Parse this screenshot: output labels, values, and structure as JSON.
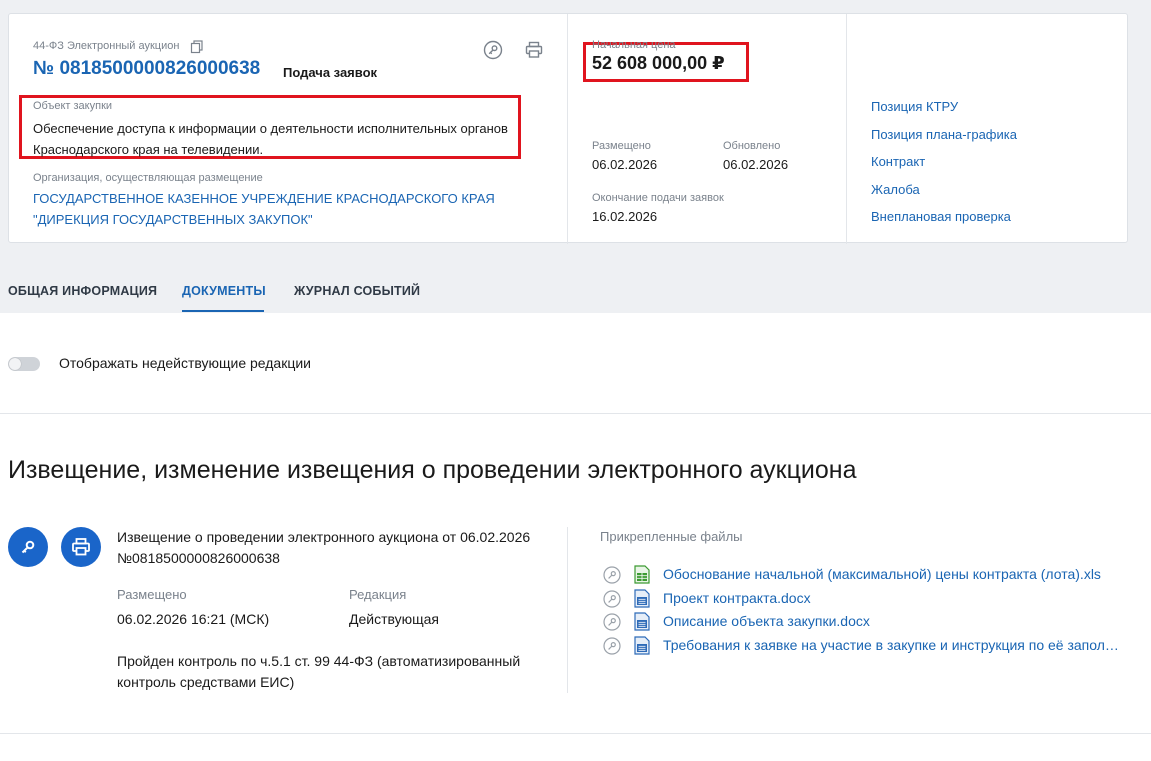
{
  "header": {
    "law_type": "44-ФЗ Электронный аукцион",
    "reg_number": "№ 0818500000826000638",
    "status": "Подача заявок",
    "object_label": "Объект закупки",
    "object_text": "Обеспечение доступа к информации о деятельности исполнительных органов Краснодарского края на телевидении.",
    "org_label": "Организация, осуществляющая размещение",
    "org_text": "ГОСУДАРСТВЕННОЕ КАЗЕННОЕ УЧРЕЖДЕНИЕ КРАСНОДАРСКОГО КРАЯ \"ДИРЕКЦИЯ ГОСУДАРСТВЕННЫХ ЗАКУПОК\""
  },
  "price": {
    "label": "Начальная цена",
    "value": "52 608 000,00 ₽"
  },
  "dates": {
    "placed_label": "Размещено",
    "placed_value": "06.02.2026",
    "updated_label": "Обновлено",
    "updated_value": "06.02.2026",
    "deadline_label": "Окончание подачи заявок",
    "deadline_value": "16.02.2026"
  },
  "side_links": [
    "Позиция КТРУ",
    "Позиция плана-графика",
    "Контракт",
    "Жалоба",
    "Внеплановая проверка"
  ],
  "tabs": [
    "ОБЩАЯ ИНФОРМАЦИЯ",
    "ДОКУМЕНТЫ",
    "ЖУРНАЛ СОБЫТИЙ"
  ],
  "toggle": {
    "label": "Отображать недействующие редакции"
  },
  "section": {
    "title": "Извещение, изменение извещения о проведении электронного аукциона",
    "notice_title": "Извещение о проведении электронного аукциона от 06.02.2026 №0818500000826000638",
    "placed_label": "Размещено",
    "placed_value": "06.02.2026 16:21 (МСК)",
    "edition_label": "Редакция",
    "edition_value": "Действующая",
    "control_text": "Пройден контроль по ч.5.1 ст. 99 44-ФЗ (автоматизированный контроль средствами ЕИС)",
    "files_label": "Прикрепленные файлы",
    "files": [
      "Обоснование начальной (максимальной) цены контракта (лота).xls",
      "Проект контракта.docx",
      "Описание объекта закупки.docx",
      "Требования к заявке на участие в закупке и инструкция по её заполнению"
    ]
  },
  "colors": {
    "accent": "#1a65b3",
    "highlight": "#e0141e",
    "button": "#1a65c9"
  }
}
